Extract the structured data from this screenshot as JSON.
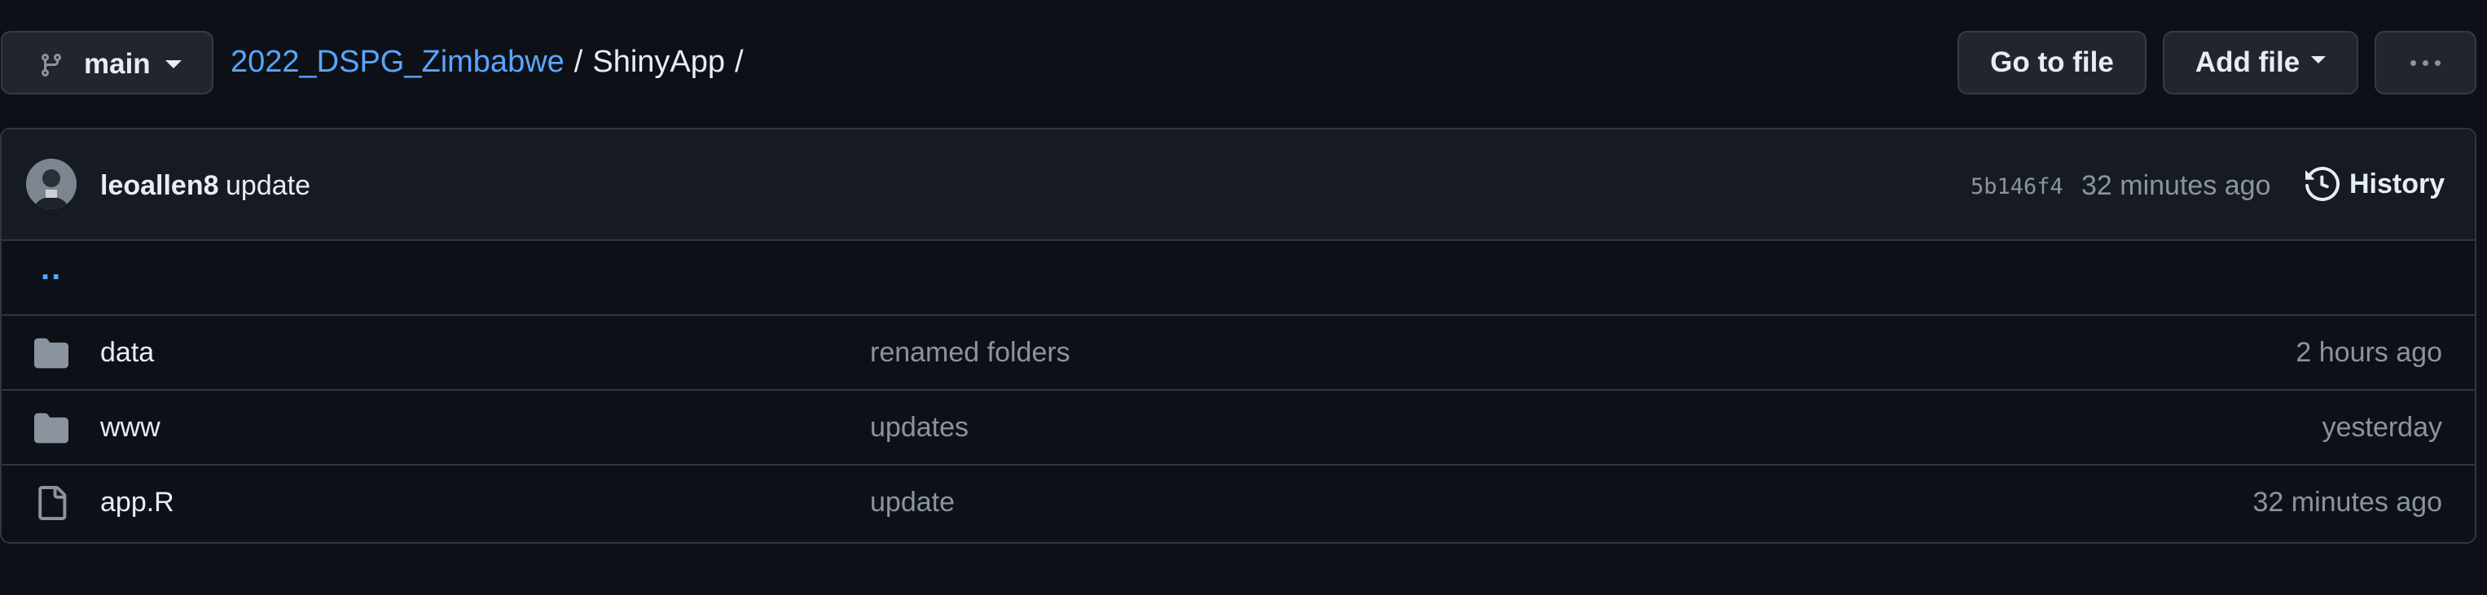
{
  "branch": {
    "name": "main",
    "icon": "git-branch-icon"
  },
  "breadcrumb": {
    "repo": "2022_DSPG_Zimbabwe",
    "separator": "/",
    "folder": "ShinyApp",
    "trailing": "/"
  },
  "actions": {
    "go_to_file": "Go to file",
    "add_file": "Add file",
    "more_icon": "kebab-horizontal-icon"
  },
  "commit": {
    "author": "leoallen8",
    "message": "update",
    "sha": "5b146f4",
    "time": "32 minutes ago",
    "history_label": "History",
    "history_icon": "history-icon"
  },
  "updir": "..",
  "files": [
    {
      "type": "folder",
      "icon": "folder-icon",
      "name": "data",
      "message": "renamed folders",
      "time": "2 hours ago"
    },
    {
      "type": "folder",
      "icon": "folder-icon",
      "name": "www",
      "message": "updates",
      "time": "yesterday"
    },
    {
      "type": "file",
      "icon": "file-icon",
      "name": "app.R",
      "message": "update",
      "time": "32 minutes ago"
    }
  ],
  "colors": {
    "background": "#0d1117",
    "header_bg": "#161b22",
    "border": "#30363d",
    "link": "#58a6ff",
    "muted": "#8b949e",
    "text": "#e6edf3",
    "button_bg": "#21262d"
  }
}
